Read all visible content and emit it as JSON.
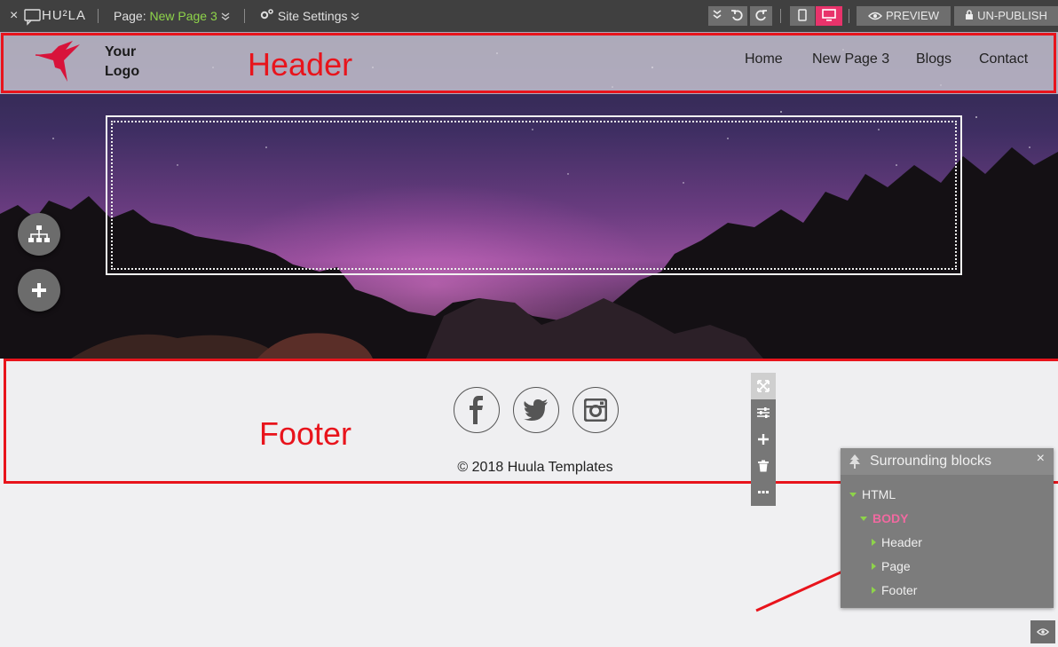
{
  "toolbar": {
    "close_glyph": "×",
    "brand": "HU²LA",
    "page_prefix": "Page:",
    "page_name": "New Page 3",
    "site_settings": "Site Settings",
    "preview": "PREVIEW",
    "unpublish": "UN-PUBLISH",
    "accent_color": "#8ed44a",
    "active_device": "desktop",
    "active_color": "#e8336b"
  },
  "header": {
    "logo_text": "Your Logo",
    "nav": [
      "Home",
      "New Page 3",
      "Blogs",
      "Contact"
    ],
    "annotation": "Header"
  },
  "footer": {
    "annotation": "Footer",
    "social": [
      "facebook-icon",
      "twitter-icon",
      "instagram-icon"
    ],
    "copyright": "© 2018 Huula Templates"
  },
  "panel": {
    "title": "Surrounding blocks",
    "close_glyph": "×",
    "tree": {
      "html": "HTML",
      "body": "BODY",
      "children": [
        "Header",
        "Page",
        "Footer"
      ]
    },
    "body_color": "#f06aa0"
  },
  "annotation_color": "#e8141c"
}
